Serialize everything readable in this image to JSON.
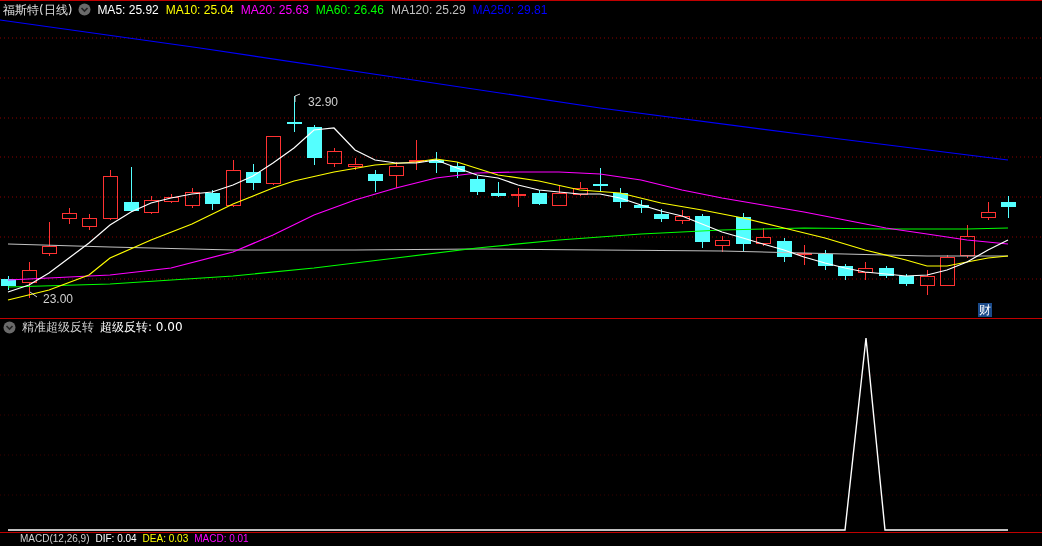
{
  "header": {
    "title": "福斯特(日线)",
    "moving_averages": [
      {
        "label": "MA5: 25.92",
        "color": "#ffffff"
      },
      {
        "label": "MA10: 25.04",
        "color": "#ffff00"
      },
      {
        "label": "MA20: 25.63",
        "color": "#ff00ff"
      },
      {
        "label": "MA60: 26.46",
        "color": "#00ff00"
      },
      {
        "label": "MA120: 25.29",
        "color": "#c0c0c0"
      },
      {
        "label": "MA250: 29.81",
        "color": "#0000ff"
      }
    ]
  },
  "price_chart": {
    "high_label": "32.90",
    "low_label": "23.00",
    "badge": "财"
  },
  "indicator": {
    "name": "精准超级反转",
    "readout": "超级反转: 0.00"
  },
  "macd": {
    "name": "MACD(12,26,9)",
    "readings": [
      {
        "label": "DIF: 0.04",
        "color": "#ffffff"
      },
      {
        "label": "DEA: 0.03",
        "color": "#ffff00"
      },
      {
        "label": "MACD: 0.01",
        "color": "#ff00ff"
      }
    ]
  }
}
